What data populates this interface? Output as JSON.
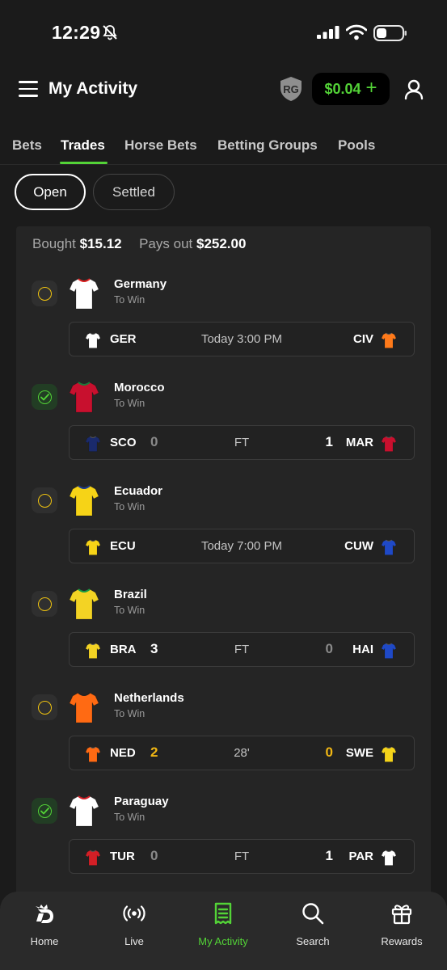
{
  "status_bar": {
    "time": "12:29"
  },
  "header": {
    "title": "My Activity",
    "rg_badge": "RG",
    "balance": "$0.04",
    "balance_plus": "+"
  },
  "tabs": [
    {
      "label": "Bets",
      "active": false
    },
    {
      "label": "Trades",
      "active": true
    },
    {
      "label": "Horse Bets",
      "active": false
    },
    {
      "label": "Betting Groups",
      "active": false
    },
    {
      "label": "Pools",
      "active": false
    }
  ],
  "filters": {
    "open": "Open",
    "settled": "Settled"
  },
  "summary": {
    "bought_label": "Bought",
    "bought_value": "$15.12",
    "payout_label": "Pays out",
    "payout_value": "$252.00"
  },
  "picks": [
    {
      "team": "Germany",
      "market": "To Win",
      "status": "open",
      "jersey": "#ffffff",
      "jersey_trim": "#d22",
      "home_code": "GER",
      "away_code": "CIV",
      "home_jersey": "#ffffff",
      "away_jersey": "#ff7a1a",
      "home_score": "",
      "away_score": "",
      "clock": "Today 3:00 PM",
      "state": "scheduled"
    },
    {
      "team": "Morocco",
      "market": "To Win",
      "status": "won",
      "jersey": "#c8102e",
      "jersey_trim": "#1c7a3a",
      "home_code": "SCO",
      "away_code": "MAR",
      "home_jersey": "#1a2a6c",
      "away_jersey": "#c8102e",
      "home_score": "0",
      "away_score": "1",
      "clock": "FT",
      "state": "final",
      "winner": "away"
    },
    {
      "team": "Ecuador",
      "market": "To Win",
      "status": "open",
      "jersey": "#f6d317",
      "jersey_trim": "#1d3c8f",
      "home_code": "ECU",
      "away_code": "CUW",
      "home_jersey": "#f6d317",
      "away_jersey": "#1f49c6",
      "home_score": "",
      "away_score": "",
      "clock": "Today 7:00 PM",
      "state": "scheduled"
    },
    {
      "team": "Brazil",
      "market": "To Win",
      "status": "open",
      "jersey": "#f3d324",
      "jersey_trim": "#169b45",
      "home_code": "BRA",
      "away_code": "HAI",
      "home_jersey": "#f3d324",
      "away_jersey": "#1f49c6",
      "home_score": "3",
      "away_score": "0",
      "clock": "FT",
      "state": "final",
      "winner": "home"
    },
    {
      "team": "Netherlands",
      "market": "To Win",
      "status": "open",
      "jersey": "#ff6a13",
      "jersey_trim": "#222",
      "home_code": "NED",
      "away_code": "SWE",
      "home_jersey": "#ff6a13",
      "away_jersey": "#f5d41a",
      "home_score": "2",
      "away_score": "0",
      "clock": "28'",
      "state": "live"
    },
    {
      "team": "Paraguay",
      "market": "To Win",
      "status": "won",
      "jersey": "#ffffff",
      "jersey_trim": "#d31f26",
      "home_code": "TUR",
      "away_code": "PAR",
      "home_jersey": "#d31f26",
      "away_jersey": "#ffffff",
      "home_score": "0",
      "away_score": "1",
      "clock": "FT",
      "state": "final",
      "winner": "away"
    }
  ],
  "bottom_nav": [
    {
      "label": "Home",
      "icon": "dk-crown-icon",
      "active": false
    },
    {
      "label": "Live",
      "icon": "live-broadcast-icon",
      "active": false
    },
    {
      "label": "My Activity",
      "icon": "receipt-icon",
      "active": true
    },
    {
      "label": "Search",
      "icon": "search-icon",
      "active": false
    },
    {
      "label": "Rewards",
      "icon": "gift-icon",
      "active": false
    }
  ]
}
